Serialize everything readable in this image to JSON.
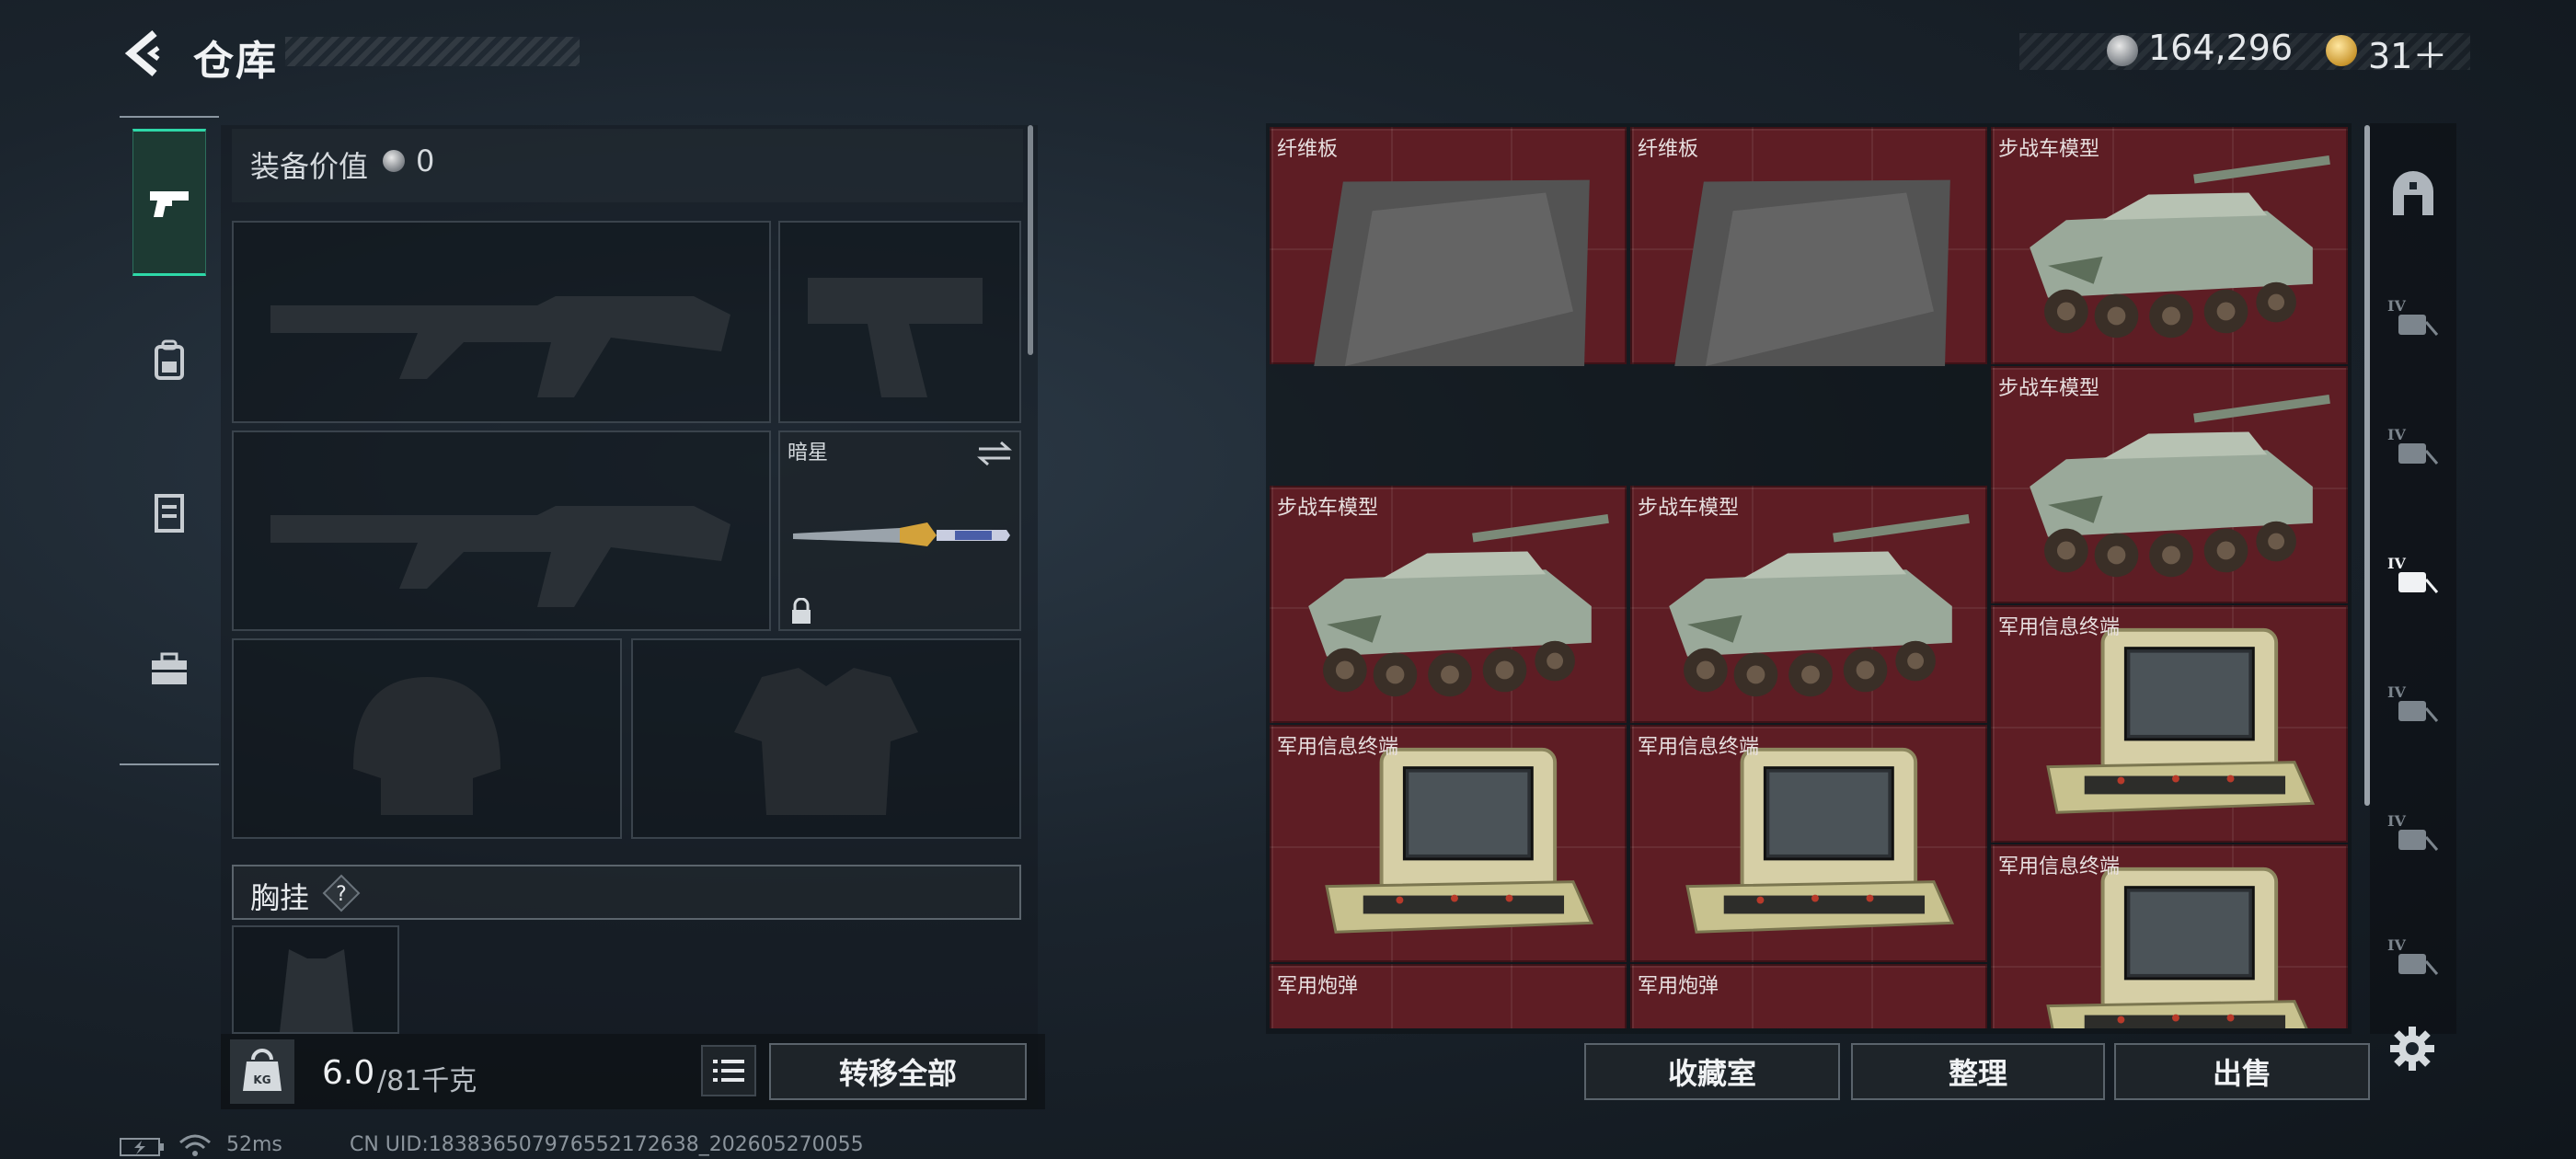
{
  "header": {
    "title": "仓库",
    "currency_silver": "164,296",
    "currency_gold": "31＋"
  },
  "equipment": {
    "value_label": "装备价值",
    "value": "0",
    "melee_name": "暗星",
    "chest_label": "胸挂",
    "help_mark": "?",
    "weight_current": "6.0",
    "weight_max": "/81千克",
    "transfer_all_label": "转移全部"
  },
  "storage": {
    "items": [
      {
        "label": "纤维板",
        "kind": "fiberboard"
      },
      {
        "label": "纤维板",
        "kind": "fiberboard"
      },
      {
        "label": "步战车模型",
        "kind": "ifv"
      },
      {
        "label": "步战车模型",
        "kind": "ifv"
      },
      {
        "label": "步战车模型",
        "kind": "ifv"
      },
      {
        "label": "步战车模型",
        "kind": "ifv"
      },
      {
        "label": "军用信息终端",
        "kind": "terminal"
      },
      {
        "label": "军用信息终端",
        "kind": "terminal"
      },
      {
        "label": "军用信息终端",
        "kind": "terminal"
      },
      {
        "label": "军用信息终端",
        "kind": "terminal"
      },
      {
        "label": "军用炮弹",
        "kind": "shell"
      },
      {
        "label": "军用炮弹",
        "kind": "shell"
      }
    ],
    "collection_label": "收藏室",
    "sort_label": "整理",
    "sell_label": "出售"
  },
  "side_tabs": [
    "tab-arch-icon",
    "tab-iv-1",
    "tab-iv-2",
    "tab-iv-3-active",
    "tab-iv-4",
    "tab-iv-5",
    "tab-iv-6"
  ],
  "status": {
    "ping": "52ms",
    "uid": "CN UID:18383650797655217263​8_202605270055"
  },
  "colors": {
    "accent_teal": "#2ed8a8",
    "storage_red": "#5e1d24",
    "background": "#1b242d"
  }
}
